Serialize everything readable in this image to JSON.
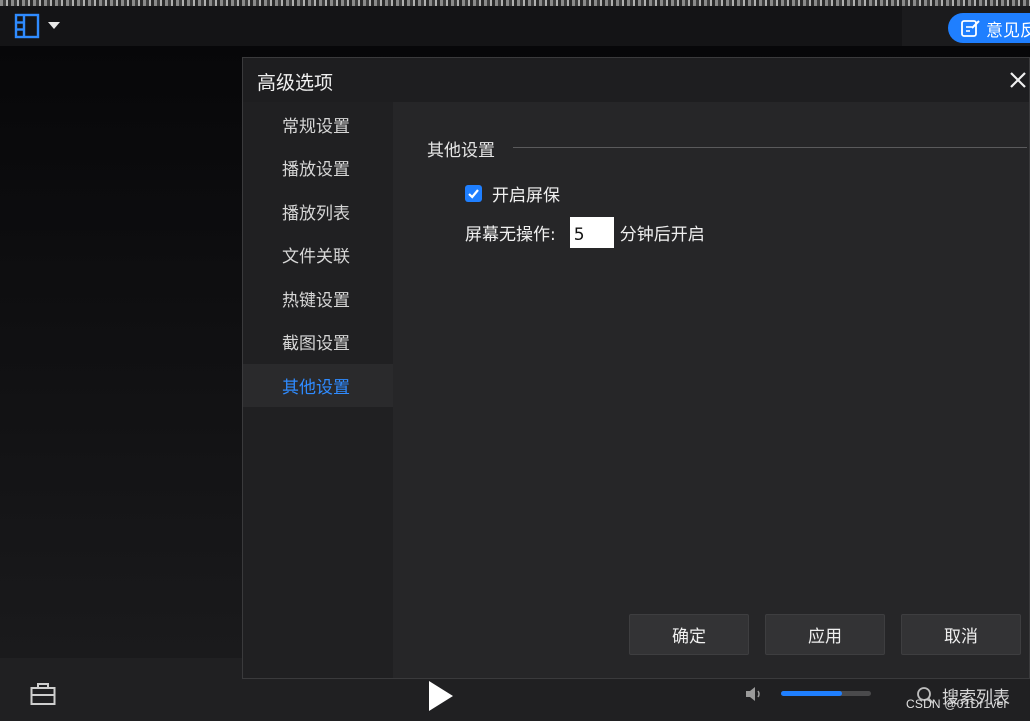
{
  "player": {
    "feedback_label": "意见反馈",
    "search_list_label": "搜索列表",
    "volume_level": 0.68,
    "accent_color": "#1f7fff"
  },
  "dialog": {
    "title": "高级选项",
    "nav": [
      {
        "label": "常规设置",
        "active": false
      },
      {
        "label": "播放设置",
        "active": false
      },
      {
        "label": "播放列表",
        "active": false
      },
      {
        "label": "文件关联",
        "active": false
      },
      {
        "label": "热键设置",
        "active": false
      },
      {
        "label": "截图设置",
        "active": false
      },
      {
        "label": "其他设置",
        "active": true
      }
    ],
    "section_title": "其他设置",
    "screensaver_label": "开启屏保",
    "screensaver_checked": true,
    "idle_label": "屏幕无操作:",
    "idle_minutes": "5",
    "idle_suffix": "分钟后开启",
    "buttons": {
      "ok": "确定",
      "apply": "应用",
      "cancel": "取消"
    }
  },
  "watermark": "CSDN @01Dr1ver",
  "icons": [
    "menu-grid-icon",
    "dropdown-caret-icon",
    "edit-icon",
    "close-icon",
    "toolbox-icon",
    "play-icon",
    "volume-icon",
    "search-icon",
    "checkmark-icon"
  ]
}
